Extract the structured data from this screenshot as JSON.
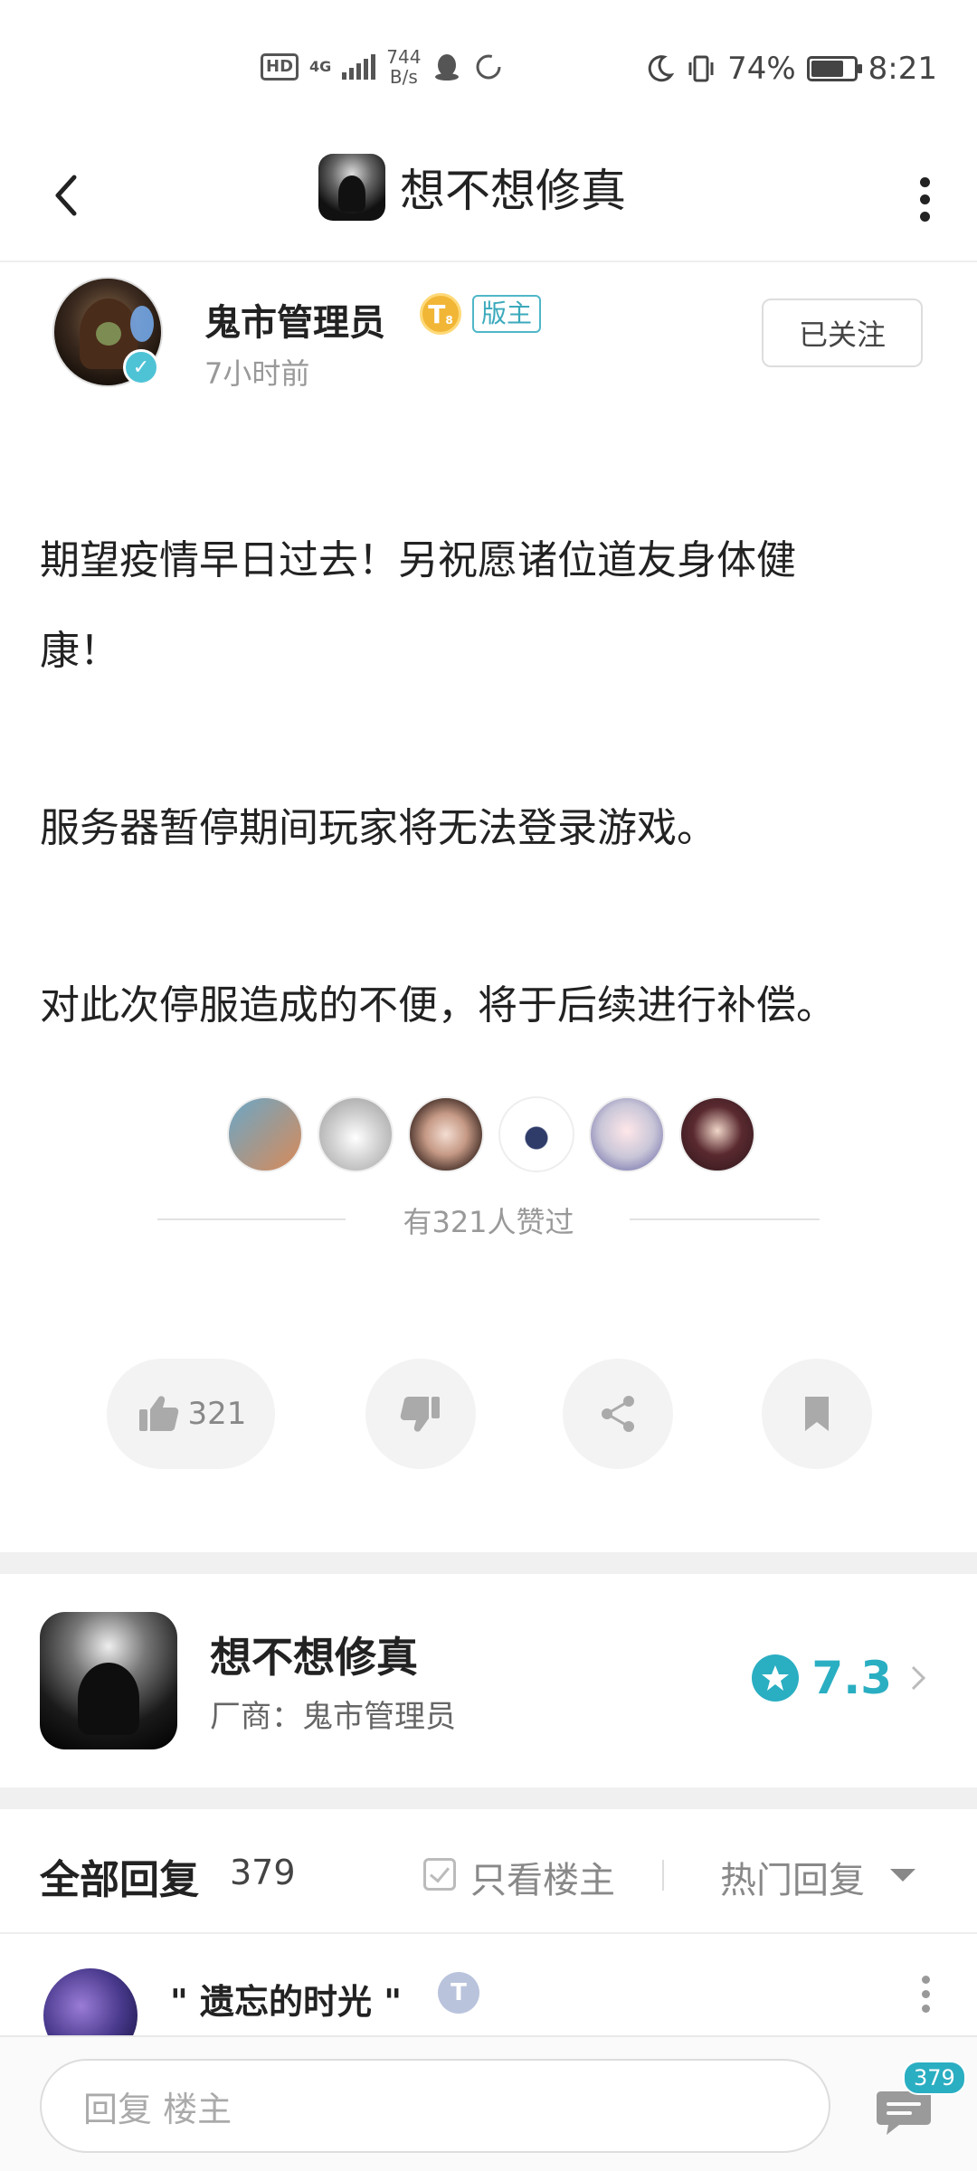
{
  "status_bar": {
    "hd": "HD",
    "network": "4G",
    "speed_value": "744",
    "speed_unit": "B/s",
    "battery_percent": "74%",
    "battery_level": 0.74,
    "time": "8:21"
  },
  "header": {
    "title": "想不想修真"
  },
  "author": {
    "name": "鬼市管理员",
    "level_badge": "T",
    "level_sub": "8",
    "role": "版主",
    "time_ago": "7小时前",
    "follow_label": "已关注"
  },
  "post": {
    "paragraphs": [
      "期望疫情早日过去！另祝愿诸位道友身体健",
      "康！",
      "服务器暂停期间玩家将无法登录游戏。",
      "对此次停服造成的不便，将于后续进行补偿。"
    ],
    "likes_text": "有321人赞过"
  },
  "actions": {
    "like_count": "321"
  },
  "game_card": {
    "name": "想不想修真",
    "vendor": "厂商：鬼市管理员",
    "score": "7.3"
  },
  "replies": {
    "title": "全部回复",
    "count": "379",
    "only_op_label": "只看楼主",
    "sort_label": "热门回复",
    "first_reply_name": "\" 遗忘的时光 \"",
    "first_reply_level": "T"
  },
  "bottom": {
    "input_placeholder": "回复  楼主",
    "comment_badge": "379"
  },
  "colors": {
    "accent": "#2aaec2",
    "text_primary": "#222222",
    "text_secondary": "#999999"
  }
}
